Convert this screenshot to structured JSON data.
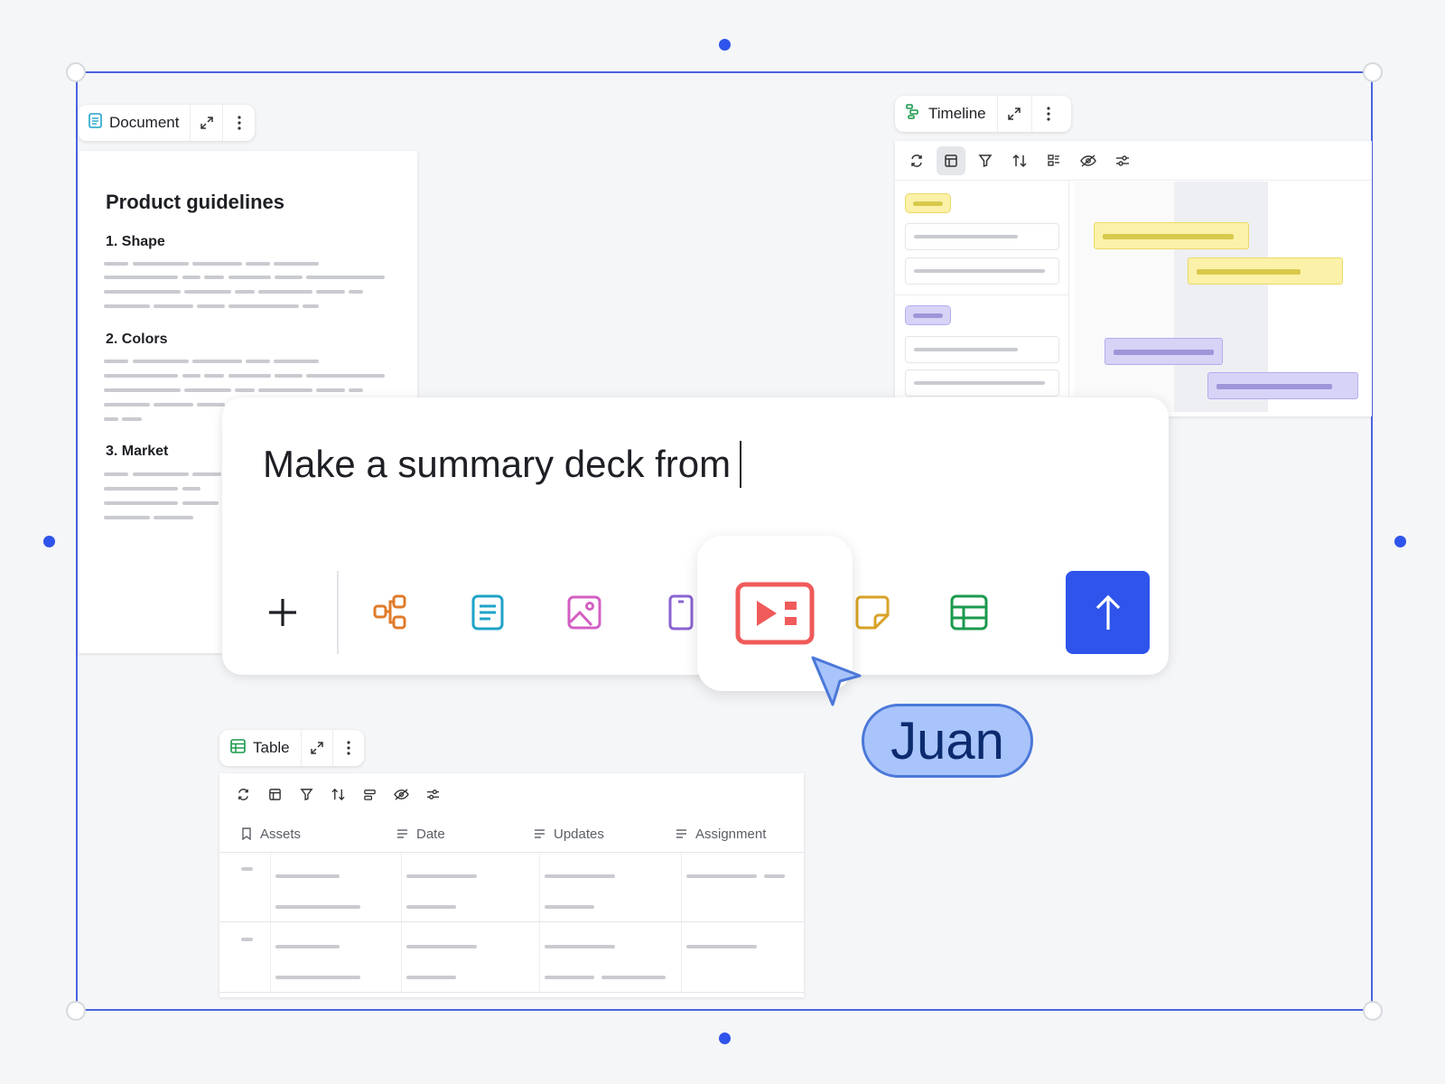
{
  "document": {
    "header_label": "Document",
    "title": "Product guidelines",
    "sections": [
      "1. Shape",
      "2. Colors",
      "3. Market"
    ]
  },
  "timeline": {
    "header_label": "Timeline"
  },
  "prompt": {
    "text": "Make a summary deck from",
    "tools": [
      "add-icon",
      "diagram-icon",
      "document-icon",
      "image-icon",
      "mobile-icon",
      "presentation-icon",
      "sticky-note-icon",
      "table-icon"
    ],
    "send_icon": "arrow-up-icon"
  },
  "collaborator": {
    "name": "Juan"
  },
  "table": {
    "header_label": "Table",
    "columns": [
      "Assets",
      "Date",
      "Updates",
      "Assignment"
    ]
  },
  "colors": {
    "accent": "#2f54eb",
    "selection": "#4b63e0",
    "presentation": "#f05a5a",
    "cursor_fill": "#a9c4fb"
  }
}
